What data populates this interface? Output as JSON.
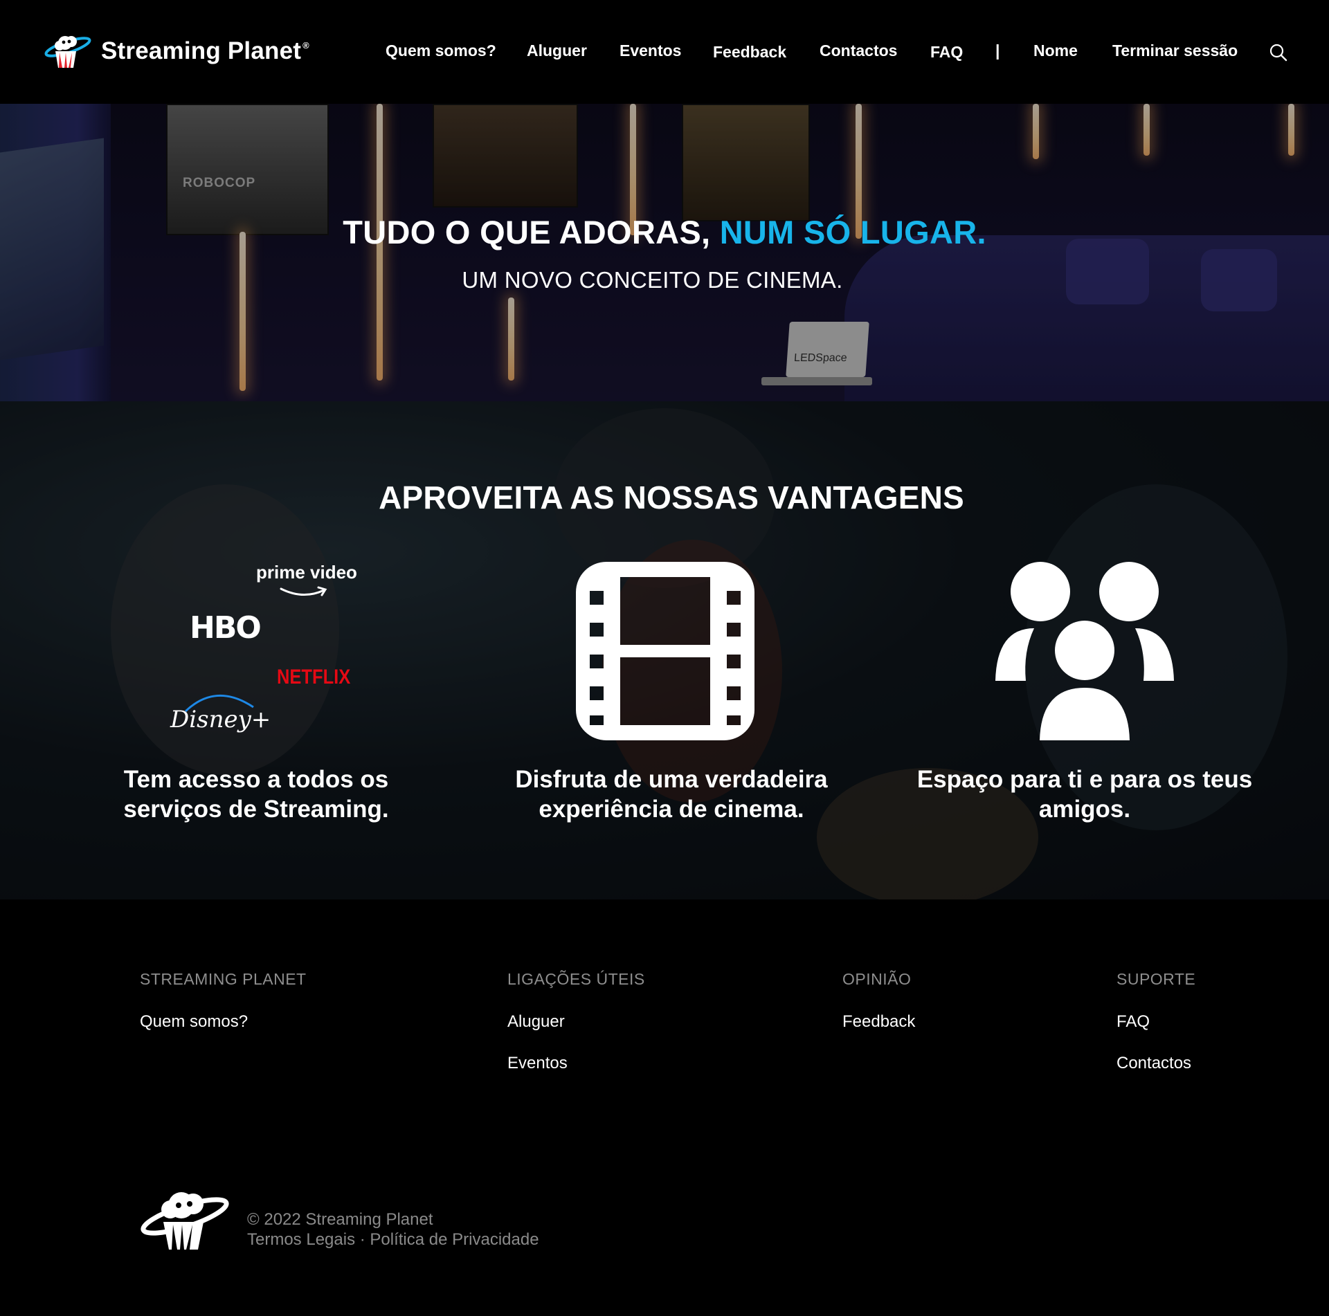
{
  "brand": {
    "name": "Streaming Planet",
    "registered": "®",
    "logo_icon": "planet-popcorn-logo-icon"
  },
  "nav": {
    "items": [
      "Quem somos?",
      "Aluguer",
      "Eventos",
      "Feedback",
      "Contactos",
      "FAQ"
    ],
    "separator": "|",
    "user_name": "Nome",
    "logout": "Terminar sessão",
    "search_icon": "search-icon"
  },
  "hero": {
    "title_main": "TUDO O QUE ADORAS, ",
    "title_accent": "NUM SÓ LUGAR.",
    "subtitle": "UM NOVO CONCEITO DE CINEMA.",
    "accent_color": "#18b4ea",
    "scene_text": {
      "poster": "ROBOCOP",
      "laptop": "LEDSpace"
    }
  },
  "advantages": {
    "title": "APROVEITA AS NOSSAS VANTAGENS",
    "items": [
      {
        "text": "Tem acesso a todos os serviços de Streaming.",
        "logos": [
          "prime video",
          "HBO",
          "NETFLIX",
          "Disney+"
        ]
      },
      {
        "text": "Disfruta de uma verdadeira experiência de cinema.",
        "icon": "film-strip-icon"
      },
      {
        "text": "Espaço para ti e para os teus amigos.",
        "icon": "group-people-icon"
      }
    ]
  },
  "footer": {
    "columns": [
      {
        "heading": "STREAMING PLANET",
        "links": [
          "Quem somos?"
        ]
      },
      {
        "heading": "LIGAÇÕES ÚTEIS",
        "links": [
          "Aluguer",
          "Eventos"
        ]
      },
      {
        "heading": "OPINIÃO",
        "links": [
          "Feedback"
        ]
      },
      {
        "heading": "SUPORTE",
        "links": [
          "FAQ",
          "Contactos"
        ]
      }
    ],
    "copyright": "© 2022 Streaming Planet",
    "legal": {
      "terms": "Termos Legais",
      "separator": " · ",
      "privacy": "Política de Privacidade"
    }
  },
  "colors": {
    "background": "#000000",
    "footer_heading": "#8e8e8e",
    "netflix_red": "#e50914"
  }
}
